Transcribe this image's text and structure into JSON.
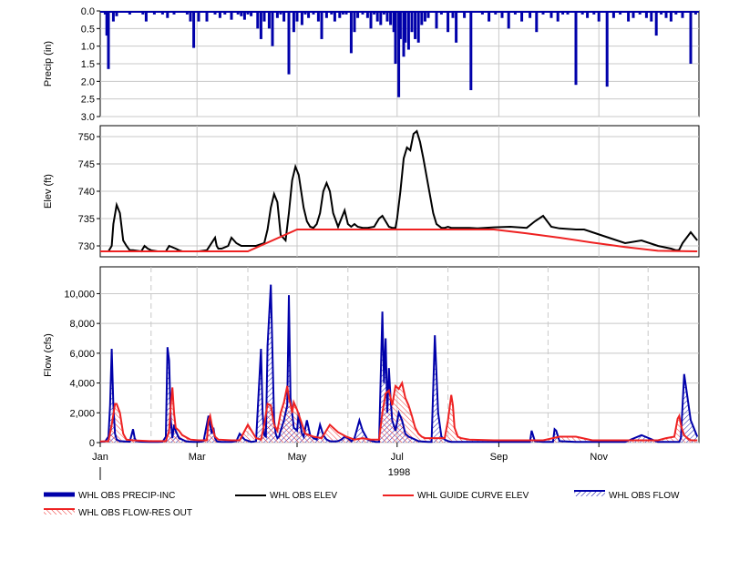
{
  "chart_data": [
    {
      "type": "bar",
      "panel": "precip",
      "ylabel": "Precip (in)",
      "ylim": [
        0,
        3.0
      ],
      "y_inverted": true,
      "yticks": [
        "0.0",
        "0.5",
        "1.0",
        "1.5",
        "2.0",
        "2.5",
        "3.0"
      ],
      "series": [
        {
          "name": "WHL OBS PRECIP-INC",
          "color": "#0000aa",
          "x_day": [
            3,
            4,
            5,
            8,
            10,
            14,
            18,
            22,
            26,
            28,
            33,
            38,
            41,
            45,
            53,
            55,
            57,
            60,
            63,
            65,
            70,
            73,
            76,
            80,
            84,
            86,
            88,
            90,
            92,
            96,
            98,
            100,
            103,
            105,
            108,
            110,
            112,
            115,
            118,
            120,
            123,
            125,
            127,
            130,
            133,
            135,
            138,
            141,
            143,
            146,
            148,
            150,
            153,
            155,
            157,
            160,
            163,
            165,
            167,
            169,
            171,
            173,
            175,
            177,
            179,
            180,
            182,
            183,
            185,
            186,
            188,
            190,
            192,
            194,
            196,
            198,
            200,
            205,
            208,
            212,
            215,
            217,
            222,
            226,
            233,
            237,
            241,
            245,
            249,
            253,
            257,
            262,
            266,
            270,
            275,
            279,
            282,
            285,
            290,
            294,
            297,
            301,
            304,
            309,
            313,
            317,
            322,
            325,
            329,
            333,
            336,
            339,
            342,
            345,
            348,
            351,
            355,
            360,
            363
          ],
          "values": [
            0.1,
            0.7,
            1.65,
            0.3,
            0.15,
            0.05,
            0.1,
            0.05,
            0.1,
            0.3,
            0.1,
            0.1,
            0.2,
            0.1,
            0.1,
            0.3,
            1.05,
            0.3,
            0.05,
            0.3,
            0.1,
            0.2,
            0.1,
            0.25,
            0.1,
            0.15,
            0.25,
            0.1,
            0.15,
            0.5,
            0.8,
            0.3,
            0.5,
            1.0,
            0.2,
            0.1,
            0.3,
            1.8,
            0.6,
            0.3,
            0.4,
            0.1,
            0.2,
            0.1,
            0.3,
            0.8,
            0.2,
            0.1,
            0.3,
            0.2,
            0.1,
            0.1,
            1.2,
            0.6,
            0.2,
            0.1,
            0.2,
            0.5,
            0.1,
            0.3,
            0.4,
            0.1,
            0.3,
            0.4,
            0.6,
            1.5,
            2.45,
            0.8,
            1.3,
            0.9,
            1.1,
            0.6,
            0.8,
            0.9,
            0.4,
            0.3,
            0.2,
            0.5,
            0.1,
            0.6,
            0.2,
            0.9,
            0.2,
            2.25,
            0.1,
            0.3,
            0.1,
            0.2,
            0.5,
            0.1,
            0.3,
            0.2,
            0.6,
            0.1,
            0.2,
            0.3,
            0.1,
            0.1,
            2.1,
            0.1,
            0.2,
            0.1,
            0.3,
            2.15,
            0.2,
            0.1,
            0.3,
            0.2,
            0.1,
            0.2,
            0.3,
            0.7,
            0.1,
            0.2,
            0.3,
            0.1,
            0.2,
            1.5,
            0.1
          ]
        }
      ]
    },
    {
      "type": "line",
      "panel": "elev",
      "ylabel": "Elev (ft)",
      "ylim": [
        728,
        752
      ],
      "yticks": [
        "730",
        "735",
        "740",
        "745",
        "750"
      ],
      "series": [
        {
          "name": "WHL OBS ELEV",
          "color": "#000000",
          "x_day": [
            0,
            5,
            7,
            8,
            10,
            12,
            14,
            16,
            18,
            20,
            25,
            27,
            29,
            31,
            35,
            40,
            42,
            46,
            48,
            50,
            52,
            55,
            60,
            65,
            70,
            71,
            72,
            74,
            78,
            80,
            83,
            86,
            90,
            95,
            100,
            102,
            104,
            106,
            108,
            110,
            113,
            115,
            117,
            119,
            121,
            124,
            126,
            128,
            130,
            132,
            134,
            136,
            138,
            140,
            142,
            145,
            147,
            149,
            151,
            153,
            155,
            157,
            160,
            163,
            167,
            170,
            172,
            174,
            176,
            178,
            180,
            181,
            183,
            185,
            187,
            189,
            191,
            193,
            195,
            197,
            200,
            203,
            205,
            208,
            210,
            212,
            214,
            216,
            220,
            225,
            230,
            240,
            250,
            260,
            265,
            270,
            275,
            280,
            285,
            290,
            295,
            300,
            305,
            310,
            320,
            330,
            340,
            348,
            350,
            351,
            352,
            353,
            355,
            360,
            364
          ],
          "values": [
            729,
            729,
            730,
            734,
            737.5,
            736,
            731,
            730,
            729.2,
            729.2,
            729,
            730,
            729.5,
            729.2,
            729,
            729,
            730,
            729.5,
            729.2,
            729,
            729,
            729,
            729,
            729.2,
            731.5,
            730,
            729.5,
            729.5,
            730,
            731.5,
            730.5,
            730,
            730,
            730,
            730.5,
            733,
            737,
            739.5,
            738,
            732,
            731,
            736,
            742,
            744.5,
            743,
            737,
            734.5,
            733.5,
            733.3,
            734,
            736,
            740,
            741.5,
            740,
            736,
            733.5,
            735,
            736.5,
            734,
            733.5,
            734,
            733.5,
            733.3,
            733.3,
            733.5,
            735,
            735.5,
            734.5,
            733.5,
            733.3,
            733.3,
            735,
            740,
            746,
            748,
            747.5,
            750.5,
            751,
            749,
            746,
            741,
            736,
            734,
            733.3,
            733.3,
            733.5,
            733.3,
            733.3,
            733.3,
            733.3,
            733.2,
            733.4,
            733.5,
            733.3,
            734.5,
            735.5,
            733.5,
            733.2,
            733.1,
            733,
            733,
            732.5,
            732,
            731.5,
            730.5,
            731,
            730,
            729.5,
            729.3,
            729.2,
            729.2,
            729.3,
            730.5,
            732.5,
            731,
            729.5,
            729.3,
            729.2,
            729.1
          ]
        },
        {
          "name": "WHL GUIDE CURVE ELEV",
          "color": "#ee2222",
          "x_day": [
            0,
            90,
            120,
            130,
            150,
            200,
            240,
            260,
            280,
            300,
            320,
            340,
            364
          ],
          "values": [
            729,
            729,
            733,
            733,
            733,
            733,
            733,
            732.3,
            731.5,
            730.6,
            729.8,
            729.1,
            729
          ]
        }
      ]
    },
    {
      "type": "line",
      "panel": "flow",
      "ylabel": "Flow (cfs)",
      "xlabel": "1998",
      "ylim": [
        0,
        11800
      ],
      "yticks": [
        "0",
        "2,000",
        "4,000",
        "6,000",
        "8,000",
        "10,000"
      ],
      "xticks": [
        {
          "label": "Jan",
          "day": 0
        },
        {
          "label": "Mar",
          "day": 59
        },
        {
          "label": "May",
          "day": 120
        },
        {
          "label": "Jul",
          "day": 181
        },
        {
          "label": "Sep",
          "day": 243
        },
        {
          "label": "Nov",
          "day": 304
        }
      ],
      "series": [
        {
          "name": "WHL OBS FLOW",
          "color": "#0000aa",
          "x_day": [
            0,
            3,
            5,
            6,
            7,
            8,
            9,
            10,
            12,
            15,
            18,
            20,
            21,
            22,
            25,
            30,
            35,
            38,
            40,
            41,
            42,
            43,
            44,
            45,
            46,
            48,
            50,
            52,
            54,
            57,
            60,
            63,
            66,
            68,
            69,
            70,
            71,
            72,
            74,
            77,
            80,
            83,
            85,
            88,
            92,
            95,
            98,
            99,
            100,
            101,
            102,
            104,
            106,
            107,
            108,
            109,
            110,
            112,
            114,
            115,
            116,
            118,
            120,
            121,
            122,
            123,
            124,
            126,
            128,
            130,
            132,
            134,
            136,
            138,
            140,
            142,
            145,
            147,
            149,
            151,
            153,
            155,
            158,
            160,
            163,
            166,
            168,
            170,
            172,
            173,
            174,
            175,
            176,
            177,
            178,
            180,
            182,
            184,
            186,
            188,
            190,
            192,
            194,
            196,
            198,
            200,
            202,
            204,
            206,
            208,
            210,
            212,
            214,
            216,
            220,
            230,
            240,
            250,
            260,
            262,
            263,
            265,
            270,
            275,
            276,
            277,
            278,
            280,
            290,
            300,
            310,
            315,
            320,
            330,
            340,
            350,
            352,
            353,
            354,
            356,
            360,
            364
          ],
          "values": [
            50,
            80,
            400,
            2500,
            6300,
            2500,
            600,
            200,
            100,
            80,
            60,
            900,
            300,
            100,
            60,
            50,
            50,
            60,
            400,
            6400,
            5500,
            1500,
            300,
            1200,
            800,
            300,
            200,
            100,
            60,
            50,
            50,
            100,
            1800,
            600,
            1000,
            300,
            100,
            60,
            50,
            50,
            50,
            100,
            600,
            200,
            50,
            100,
            6300,
            2000,
            500,
            400,
            6500,
            10600,
            1500,
            600,
            300,
            400,
            800,
            1500,
            2500,
            9900,
            3000,
            1000,
            800,
            2000,
            1200,
            600,
            400,
            1500,
            500,
            300,
            200,
            1200,
            500,
            200,
            100,
            80,
            100,
            200,
            400,
            300,
            100,
            300,
            1500,
            800,
            200,
            100,
            50,
            50,
            8800,
            4000,
            7000,
            2000,
            5000,
            3000,
            1500,
            800,
            2000,
            1500,
            600,
            400,
            300,
            200,
            100,
            80,
            60,
            50,
            50,
            7200,
            2000,
            400,
            200,
            100,
            50,
            40,
            40,
            40,
            40,
            40,
            40,
            40,
            800,
            100,
            40,
            40,
            40,
            900,
            800,
            100,
            40,
            40,
            40,
            40,
            40,
            500,
            40,
            40,
            40,
            40,
            300,
            4600,
            1500,
            400,
            100,
            60
          ]
        },
        {
          "name": "WHL OBS FLOW-RES OUT",
          "color": "#ee2222",
          "x_day": [
            0,
            5,
            7,
            9,
            10,
            12,
            14,
            16,
            20,
            30,
            40,
            42,
            43,
            44,
            45,
            46,
            48,
            50,
            55,
            60,
            65,
            66,
            67,
            68,
            70,
            72,
            80,
            85,
            90,
            95,
            98,
            100,
            102,
            104,
            106,
            108,
            110,
            112,
            114,
            115,
            116,
            117,
            118,
            120,
            125,
            130,
            135,
            140,
            145,
            150,
            155,
            160,
            165,
            170,
            172,
            174,
            176,
            178,
            180,
            182,
            184,
            186,
            188,
            190,
            192,
            194,
            196,
            198,
            200,
            205,
            210,
            212,
            214,
            215,
            216,
            218,
            220,
            225,
            240,
            260,
            270,
            280,
            290,
            300,
            310,
            320,
            330,
            340,
            345,
            350,
            352,
            353,
            354,
            355,
            356,
            358,
            360,
            364
          ],
          "values": [
            80,
            100,
            1200,
            2600,
            2600,
            2000,
            600,
            200,
            150,
            100,
            100,
            800,
            2500,
            3700,
            2000,
            1000,
            800,
            500,
            200,
            150,
            150,
            1500,
            1800,
            1200,
            400,
            200,
            150,
            150,
            1200,
            300,
            200,
            1200,
            2600,
            2500,
            1200,
            800,
            2000,
            2700,
            3800,
            3000,
            2600,
            2000,
            2700,
            2200,
            600,
            400,
            300,
            1200,
            700,
            400,
            200,
            300,
            200,
            200,
            2000,
            3300,
            3500,
            2500,
            3800,
            3600,
            4000,
            3000,
            2500,
            1800,
            1000,
            600,
            400,
            300,
            300,
            300,
            300,
            1500,
            3200,
            2500,
            1000,
            400,
            300,
            200,
            150,
            150,
            150,
            400,
            400,
            150,
            150,
            150,
            150,
            150,
            300,
            400,
            1600,
            1800,
            1200,
            800,
            500,
            300,
            150,
            150
          ]
        }
      ]
    }
  ],
  "legend": [
    {
      "label": "WHL OBS PRECIP-INC",
      "color": "#0000aa",
      "style": "thick"
    },
    {
      "label": "WHL OBS ELEV",
      "color": "#000000",
      "style": "line"
    },
    {
      "label": "WHL GUIDE CURVE ELEV",
      "color": "#ee2222",
      "style": "line"
    },
    {
      "label": "WHL OBS FLOW",
      "color": "#0000aa",
      "style": "hatch"
    },
    {
      "label": "WHL OBS FLOW-RES OUT",
      "color": "#ee2222",
      "style": "hatch"
    }
  ]
}
